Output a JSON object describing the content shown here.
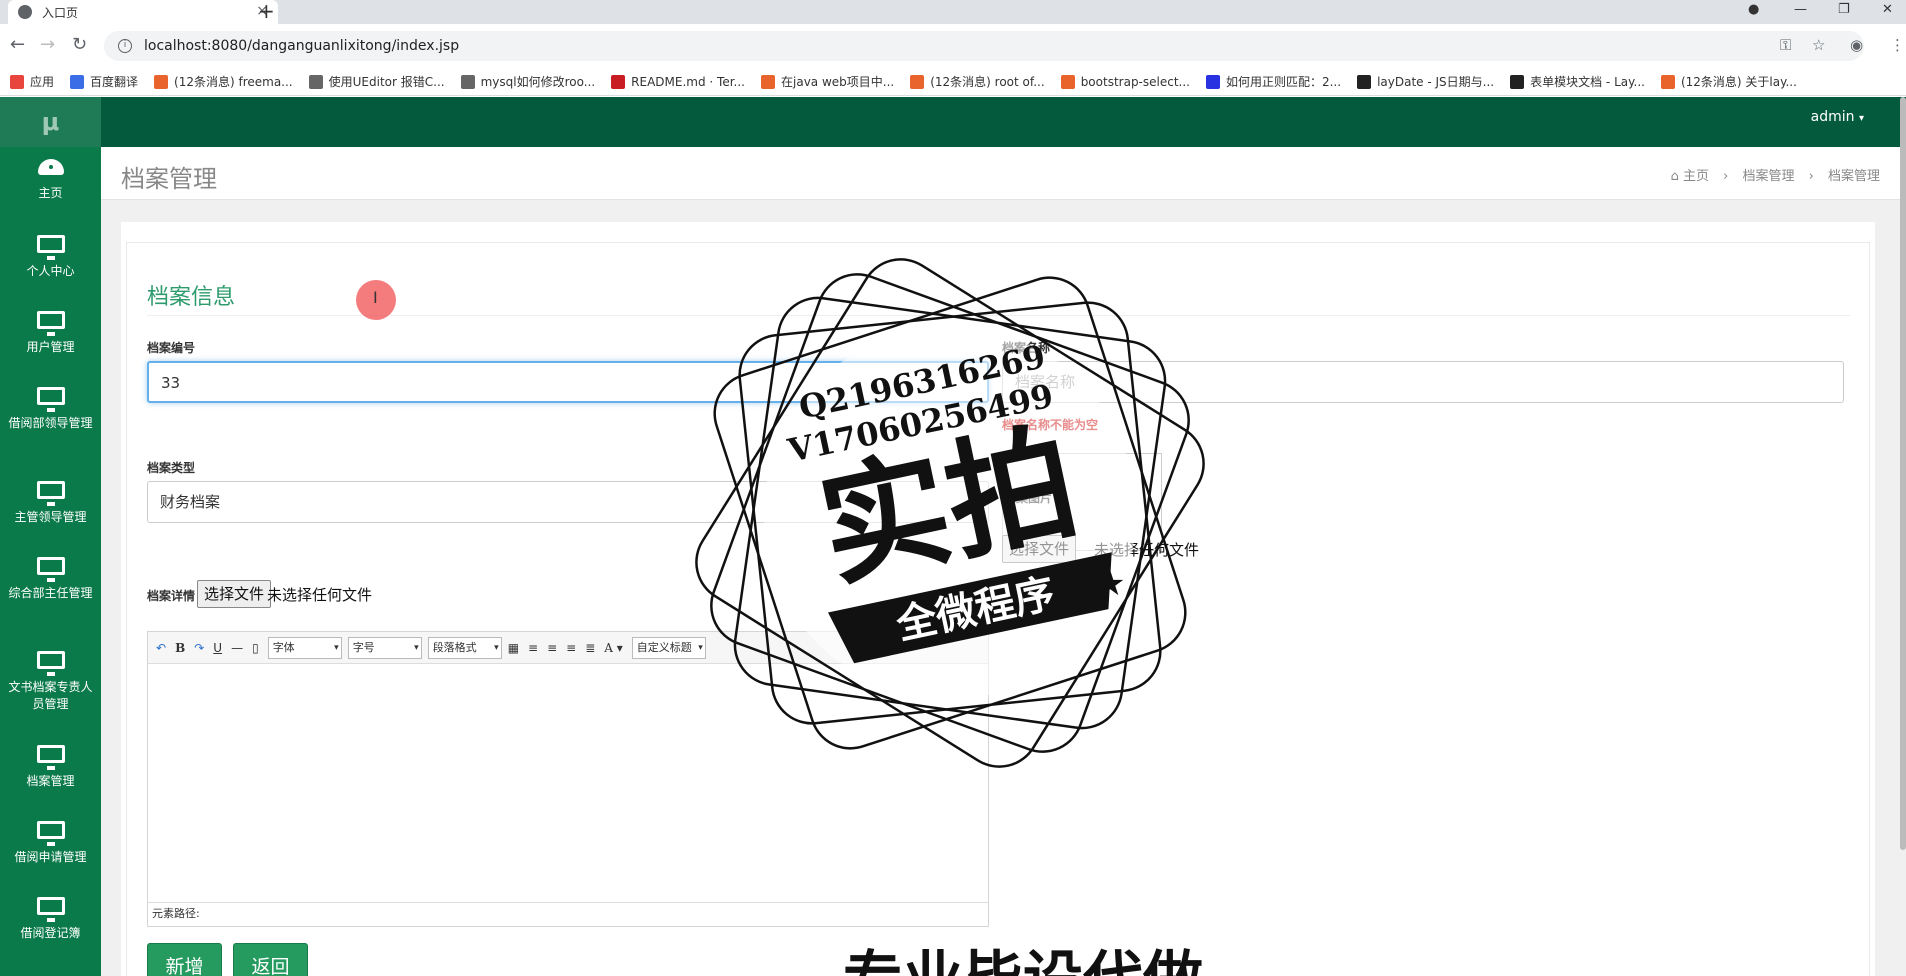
{
  "browser": {
    "tab_title": "入口页",
    "tab_close": "×",
    "new_tab": "+",
    "url": "localhost:8080/danganguanlixitong/index.jsp",
    "controls": {
      "minimize": "—",
      "restore": "❐",
      "close": "✕"
    },
    "bookmarks": [
      {
        "label": "应用",
        "icon": "apps-icon",
        "color": "#e8453c"
      },
      {
        "label": "百度翻译",
        "icon": "translate-icon",
        "color": "#3b6ee6"
      },
      {
        "label": "(12条消息) freema...",
        "icon": "csdn-icon",
        "color": "#e8642c"
      },
      {
        "label": "使用UEditor 报错C...",
        "icon": "bookmark-icon",
        "color": "#666"
      },
      {
        "label": "mysql如何修改roo...",
        "icon": "bookmark-icon",
        "color": "#666"
      },
      {
        "label": "README.md · Ter...",
        "icon": "gitee-icon",
        "color": "#c71d23"
      },
      {
        "label": "在java web项目中...",
        "icon": "csdn-icon",
        "color": "#e8642c"
      },
      {
        "label": "(12条消息) root of...",
        "icon": "csdn-icon",
        "color": "#e8642c"
      },
      {
        "label": "bootstrap-select...",
        "icon": "bookmark-icon",
        "color": "#e8642c"
      },
      {
        "label": "如何用正则匹配：2...",
        "icon": "baidu-icon",
        "color": "#2932e1"
      },
      {
        "label": "layDate - JS日期与...",
        "icon": "layui-icon",
        "color": "#222"
      },
      {
        "label": "表单模块文档 - Lay...",
        "icon": "layui-icon",
        "color": "#222"
      },
      {
        "label": "(12条消息) 关于lay...",
        "icon": "csdn-icon",
        "color": "#e8642c"
      }
    ]
  },
  "app": {
    "logo": "μ",
    "user": "admin",
    "sidebar": [
      {
        "label": "主页",
        "icon": "dashboard-icon"
      },
      {
        "label": "个人中心",
        "icon": "monitor-icon"
      },
      {
        "label": "用户管理",
        "icon": "monitor-icon"
      },
      {
        "label": "借阅部领导管理",
        "icon": "monitor-icon"
      },
      {
        "label": "主管领导管理",
        "icon": "monitor-icon"
      },
      {
        "label": "综合部主任管理",
        "icon": "monitor-icon"
      },
      {
        "label": "文书档案专责人员管理",
        "icon": "monitor-icon"
      },
      {
        "label": "档案管理",
        "icon": "monitor-icon"
      },
      {
        "label": "借阅申请管理",
        "icon": "monitor-icon"
      },
      {
        "label": "借阅登记簿",
        "icon": "monitor-icon"
      }
    ],
    "page_title": "档案管理",
    "breadcrumb": [
      "主页",
      "档案管理",
      "档案管理"
    ],
    "breadcrumb_sep": "›"
  },
  "form": {
    "section_title": "档案信息",
    "number_label": "档案编号",
    "number_value": "33",
    "name_label": "档案名称",
    "name_placeholder": "档案名称",
    "name_error": "档案名称不能为空",
    "type_label": "档案类型",
    "type_value": "财务档案",
    "image_label": "档案图片",
    "detail_label": "档案详情",
    "choose_file": "选择文件",
    "no_file": "未选择任何文件",
    "editor": {
      "font": "字体",
      "size": "字号",
      "paragraph": "段落格式",
      "custom_title": "自定义标题",
      "path_label": "元素路径:"
    },
    "add_button": "新增",
    "back_button": "返回"
  },
  "watermark": {
    "qq": "Q2196316269",
    "vx": "V17060256499",
    "main": "实拍",
    "ribbon": "全微程序",
    "bottom": "专业毕设代做"
  }
}
